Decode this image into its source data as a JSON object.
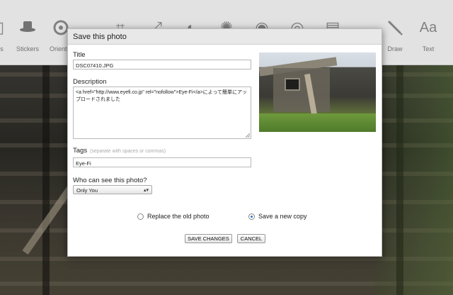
{
  "toolbar": {
    "items": [
      {
        "label": "es",
        "icon": "frames-icon"
      },
      {
        "label": "Stickers",
        "icon": "hat-icon"
      },
      {
        "label": "Orientat",
        "icon": "rotate-icon"
      },
      {
        "label": "",
        "icon": "crop-icon"
      },
      {
        "label": "",
        "icon": "resize-icon"
      },
      {
        "label": "",
        "icon": "exposure-icon"
      },
      {
        "label": "",
        "icon": "colors-icon"
      },
      {
        "label": "",
        "icon": "sharpen-icon"
      },
      {
        "label": "",
        "icon": "redeye-icon"
      },
      {
        "label": "",
        "icon": "effects-icon"
      },
      {
        "label": "Draw",
        "icon": "brush-icon"
      },
      {
        "label": "Text",
        "icon": "text-icon"
      }
    ]
  },
  "dialog": {
    "title": "Save this photo",
    "title_label": "Title",
    "title_value": "DSC07410.JPG",
    "description_label": "Description",
    "description_value": "<a href=\"http://www.eyefi.co.jp\" rel=\"nofollow\">Eye-Fi</a>によって簡単にアップロードされました",
    "tags_label": "Tags",
    "tags_hint": "(separate with spaces or commas)",
    "tags_value": "Eye-Fi",
    "visibility_label": "Who can see this photo?",
    "visibility_value": "Only You",
    "option_replace": "Replace the old photo",
    "option_copy": "Save a new copy",
    "selected_option": "copy",
    "save_button": "SAVE CHANGES",
    "cancel_button": "CANCEL"
  }
}
